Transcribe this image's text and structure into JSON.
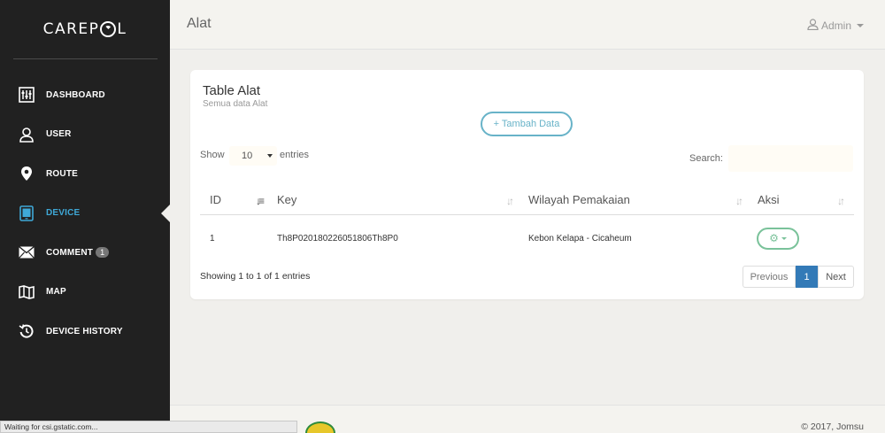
{
  "brand": {
    "logo_pre": "CAREP",
    "logo_post": "L"
  },
  "sidebar": {
    "items": [
      {
        "label": "DASHBOARD",
        "icon": "dashboard-icon"
      },
      {
        "label": "USER",
        "icon": "user-icon"
      },
      {
        "label": "ROUTE",
        "icon": "map-pin-icon"
      },
      {
        "label": "DEVICE",
        "icon": "tablet-icon",
        "active": true
      },
      {
        "label": "COMMENT",
        "icon": "envelope-icon",
        "badge": "1"
      },
      {
        "label": "MAP",
        "icon": "map-icon"
      },
      {
        "label": "DEVICE HISTORY",
        "icon": "history-icon"
      }
    ]
  },
  "header": {
    "title": "Alat",
    "user": "Admin"
  },
  "card": {
    "title": "Table Alat",
    "subtitle": "Semua data Alat",
    "add_button": "+ Tambah Data",
    "show_label": "Show",
    "length_value": "10",
    "entries_label": "entries",
    "search_label": "Search:"
  },
  "table": {
    "columns": [
      "ID",
      "Key",
      "Wilayah Pemakaian",
      "Aksi"
    ],
    "rows": [
      {
        "id": "1",
        "key": "Th8P020180226051806Th8P0",
        "wilayah": "Kebon Kelapa - Cicaheum"
      }
    ],
    "info": "Showing 1 to 1 of 1 entries",
    "pager": {
      "previous": "Previous",
      "current": "1",
      "next": "Next"
    }
  },
  "footer": {
    "copyright": "© 2017, Jomsu"
  },
  "status_bar": "Waiting for csi.gstatic.com...",
  "colors": {
    "sidebar": "#212121",
    "accent": "#3fa9d8",
    "primary_outline": "#68b3c8",
    "success_outline": "#7ac29a",
    "pager_active": "#337ab7"
  }
}
